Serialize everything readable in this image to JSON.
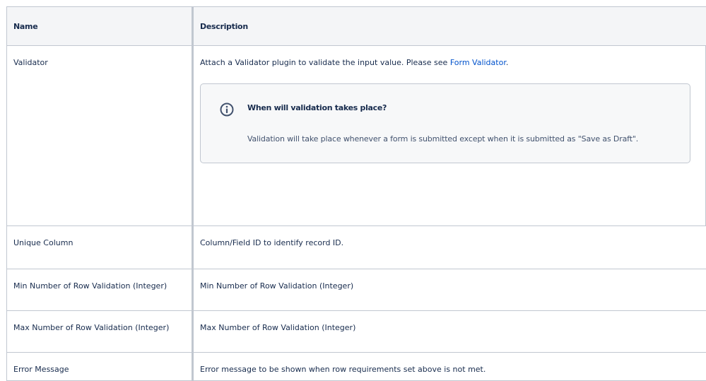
{
  "table": {
    "headers": {
      "name": "Name",
      "description": "Description"
    },
    "rows": [
      {
        "name": "Validator",
        "description_prefix": "Attach a Validator plugin to validate the input value. Please see ",
        "description_link": "Form Validator",
        "description_suffix": ".",
        "info_panel": {
          "icon": "info-icon",
          "title": "When will validation takes place?",
          "body": "Validation will take place whenever a form is submitted except when it is submitted as \"Save as Draft\"."
        }
      },
      {
        "name": "Unique Column",
        "description": "Column/Field ID to identify record ID."
      },
      {
        "name": "Min Number of Row Validation (Integer)",
        "description": "Min Number of Row Validation (Integer)"
      },
      {
        "name": "Max Number of Row Validation (Integer)",
        "description": "Max Number of Row Validation (Integer)"
      },
      {
        "name": "Error Message",
        "description": "Error message to be shown when row requirements set above is not met."
      }
    ]
  },
  "colors": {
    "text": "#172b4d",
    "link": "#0052cc",
    "border": "#c1c7d0",
    "header_bg": "#f4f5f7",
    "panel_bg": "#f7f8f9"
  }
}
